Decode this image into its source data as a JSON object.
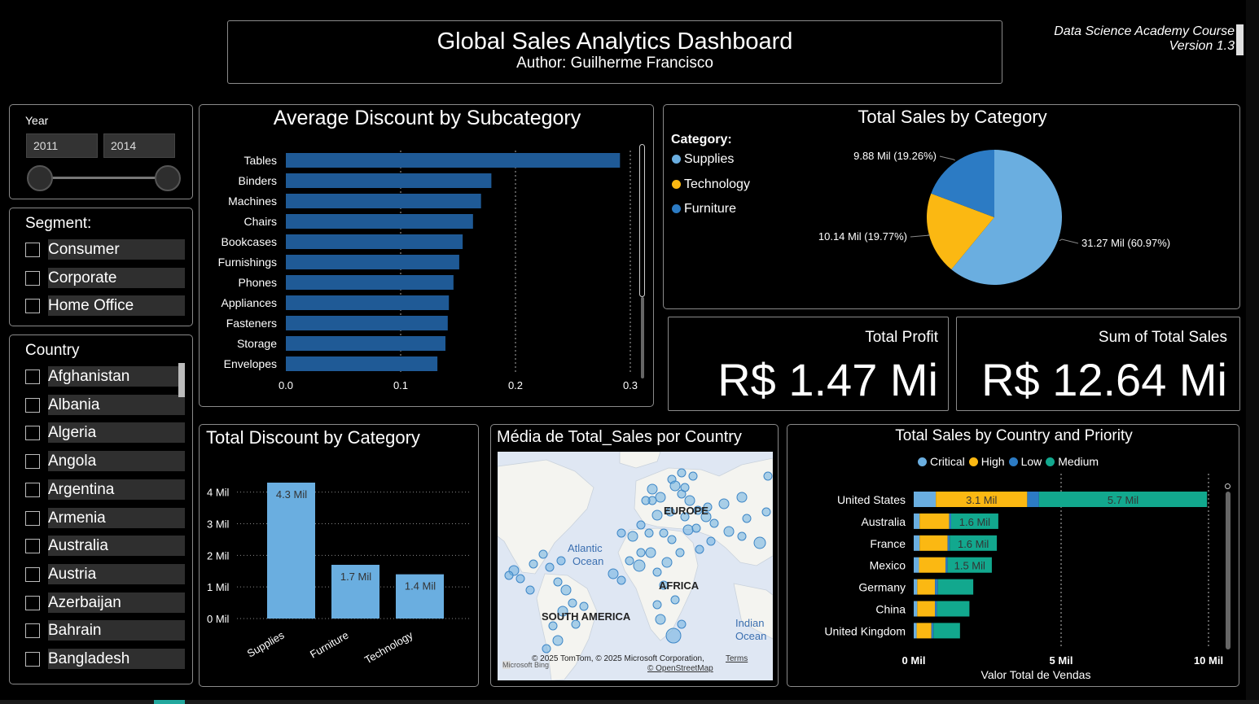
{
  "header": {
    "title": "Global Sales Analytics Dashboard",
    "author": "Author:  Guilherme Francisco",
    "course": "Data Science Academy Course",
    "version": "Version 1.3"
  },
  "year_filter": {
    "label": "Year",
    "from": "2011",
    "to": "2014"
  },
  "segment_filter": {
    "label": "Segment:",
    "items": [
      "Consumer",
      "Corporate",
      "Home Office"
    ]
  },
  "country_filter": {
    "label": "Country",
    "items": [
      "Afghanistan",
      "Albania",
      "Algeria",
      "Angola",
      "Argentina",
      "Armenia",
      "Australia",
      "Austria",
      "Azerbaijan",
      "Bahrain",
      "Bangladesh"
    ]
  },
  "kpis": {
    "profit_label": "Total Profit",
    "profit_value": "R$ 1.47 Mi",
    "sales_label": "Sum of Total Sales",
    "sales_value": "R$ 12.64 Mi"
  },
  "map": {
    "title": "Média de Total_Sales por Country",
    "labels": [
      "EUROPE",
      "Atlantic",
      "Ocean",
      "AFRICA",
      "SOUTH AMERICA",
      "Indian",
      "Ocean"
    ],
    "attribution": "© 2025 TomTom, © 2025 Microsoft Corporation,",
    "terms": "Terms",
    "osm": "© OpenStreetMap",
    "bing": "Microsoft Bing"
  },
  "colors": {
    "supplies": "#6aaee0",
    "technology": "#fbb812",
    "furniture": "#2c7bc4",
    "critical": "#6aaee0",
    "high": "#fbb812",
    "low": "#2c7bc4",
    "medium": "#12a88e",
    "bar_blue": "#1f5a96"
  },
  "chart_data": [
    {
      "type": "bar",
      "orientation": "horizontal",
      "title": "Average Discount by Subcategory",
      "categories": [
        "Tables",
        "Binders",
        "Machines",
        "Chairs",
        "Bookcases",
        "Furnishings",
        "Phones",
        "Appliances",
        "Fasteners",
        "Storage",
        "Envelopes"
      ],
      "values": [
        0.291,
        0.179,
        0.17,
        0.163,
        0.154,
        0.151,
        0.146,
        0.142,
        0.141,
        0.139,
        0.132
      ],
      "xticks": [
        "0.0",
        "0.1",
        "0.2",
        "0.3"
      ],
      "xlim": [
        0,
        0.3
      ],
      "grid": true
    },
    {
      "type": "pie",
      "title": "Total Sales by Category",
      "legend_title": "Category:",
      "categories": [
        "Supplies",
        "Technology",
        "Furniture"
      ],
      "values": [
        31.27,
        10.14,
        9.88
      ],
      "data_labels": [
        "31.27 Mil (60.97%)",
        "10.14 Mil (19.77%)",
        "9.88 Mil (19.26%)"
      ],
      "legend": "top-left"
    },
    {
      "type": "bar",
      "orientation": "vertical",
      "title": "Total Discount by Category",
      "categories": [
        "Supplies",
        "Furniture",
        "Technology"
      ],
      "values": [
        4.3,
        1.7,
        1.4
      ],
      "data_labels": [
        "4.3 Mil",
        "1.7 Mil",
        "1.4 Mil"
      ],
      "yticks": [
        "0 Mil",
        "1 Mil",
        "2 Mil",
        "3 Mil",
        "4 Mil"
      ],
      "ylim": [
        0,
        4.3
      ],
      "grid": true
    },
    {
      "type": "bar",
      "orientation": "horizontal",
      "stacked": true,
      "title": "Total Sales by Country and Priority",
      "xlabel": "Valor Total de Vendas",
      "categories": [
        "United States",
        "Australia",
        "France",
        "Mexico",
        "Germany",
        "China",
        "United Kingdom"
      ],
      "series": [
        {
          "name": "Critical",
          "values": [
            0.75,
            0.2,
            0.2,
            0.18,
            0.12,
            0.12,
            0.1
          ],
          "labels": [
            "",
            "",
            "",
            "",
            "",
            "",
            ""
          ]
        },
        {
          "name": "High",
          "values": [
            3.1,
            1.0,
            0.95,
            0.9,
            0.6,
            0.6,
            0.5
          ],
          "labels": [
            "3.1 Mil",
            "",
            "",
            "",
            "",
            "",
            ""
          ]
        },
        {
          "name": "Low",
          "values": [
            0.4,
            0.07,
            0.07,
            0.07,
            0.1,
            0.07,
            0.07
          ],
          "labels": [
            "",
            "",
            "",
            "",
            "",
            "",
            ""
          ]
        },
        {
          "name": "Medium",
          "values": [
            5.7,
            1.6,
            1.6,
            1.5,
            1.2,
            1.1,
            0.9
          ],
          "labels": [
            "5.7 Mil",
            "1.6 Mil",
            "1.6 Mil",
            "1.5 Mil",
            "",
            "",
            ""
          ]
        }
      ],
      "xticks": [
        "0 Mil",
        "5 Mil",
        "10 Mil"
      ],
      "xlim": [
        0,
        10
      ],
      "legend": "top",
      "grid": true
    }
  ]
}
